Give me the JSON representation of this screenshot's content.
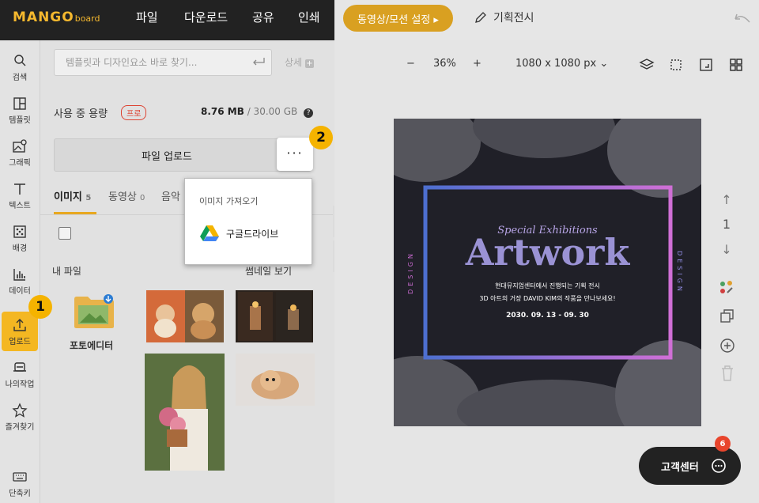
{
  "app": {
    "logo_main": "MANGO",
    "logo_sub": "board",
    "menu": [
      "파일",
      "다운로드",
      "공유",
      "인쇄"
    ],
    "motion_button": "동영상/모션 설정 ▸",
    "doc_title": "기획전시"
  },
  "rail": [
    {
      "label": "검색",
      "icon": "search-icon"
    },
    {
      "label": "템플릿",
      "icon": "template-icon"
    },
    {
      "label": "그래픽",
      "icon": "graphic-icon"
    },
    {
      "label": "텍스트",
      "icon": "text-icon"
    },
    {
      "label": "배경",
      "icon": "background-icon"
    },
    {
      "label": "데이터",
      "icon": "chart-icon"
    },
    {
      "label": "업로드",
      "icon": "upload-icon"
    },
    {
      "label": "나의작업",
      "icon": "my-work-icon"
    },
    {
      "label": "즐겨찾기",
      "icon": "star-icon"
    },
    {
      "label": "단축키",
      "icon": "keyboard-icon"
    }
  ],
  "panel": {
    "search_placeholder": "템플릿과 디자인요소 바로 찾기...",
    "detail_label": "상세",
    "usage_label": "사용 중 용량",
    "pro_badge": "프로",
    "usage_value": "8.76 MB",
    "usage_total": "/ 30.00 GB",
    "upload_button": "파일 업로드",
    "more_button": "···",
    "tabs": [
      {
        "label": "이미지",
        "count": "5"
      },
      {
        "label": "동영상",
        "count": "0"
      },
      {
        "label": "음악",
        "count": ""
      }
    ],
    "my_files_title": "내 파일",
    "thumbnail_view": "썸네일 보기",
    "photo_editor": "포토에디터"
  },
  "dropdown": {
    "title": "이미지 가져오기",
    "google_drive": "구글드라이브"
  },
  "steps": [
    "1",
    "2"
  ],
  "workspace": {
    "zoom_minus": "−",
    "zoom_value": "36%",
    "zoom_plus": "+",
    "canvas_size": "1080 x 1080 px",
    "page_number": "1"
  },
  "artwork": {
    "subtitle": "Special Exhibitions",
    "title": "Artwork",
    "line1": "현대뮤지엄센터에서 진행되는 기획 전시",
    "line2": "3D 아트의 거장 DAVID KIM의 작품을 만나보세요!",
    "date": "2030. 09. 13 - 09. 30",
    "side_text": "DESIGN"
  },
  "support": {
    "label": "고객센터",
    "badge": "6"
  },
  "colors": {
    "accent": "#f4b722",
    "topbar": "#222222"
  }
}
